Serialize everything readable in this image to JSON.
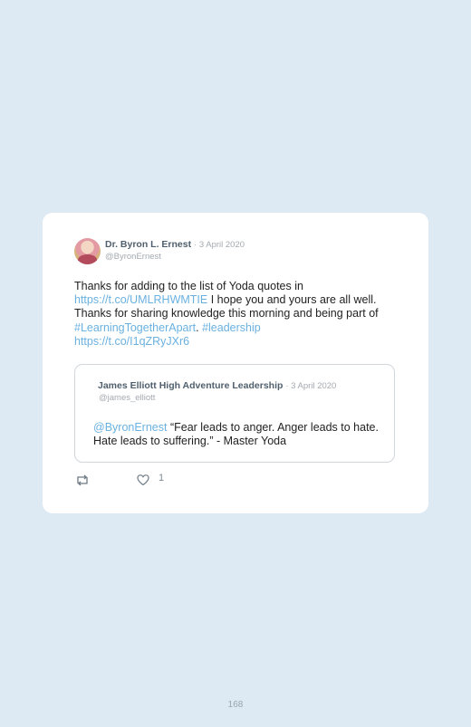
{
  "tweet": {
    "author_name": "Dr. Byron L. Ernest",
    "date": "· 3 April 2020",
    "handle": "@ByronErnest",
    "text": {
      "part1": "Thanks for adding to the list of Yoda quotes in ",
      "link1": "https://t.co/UMLRHWMTIE",
      "part2": " I hope you and yours are all well. Thanks for sharing knowledge this morning and being part of ",
      "hashtag1": "#LearningTogetherApart",
      "part3": ". ",
      "hashtag2": "#leadership",
      "link2": "https://t.co/I1qZRyJXr6"
    },
    "like_count": "1"
  },
  "quoted_tweet": {
    "author_name": "James Elliott High Adventure Leadership",
    "date": "· 3 April 2020",
    "handle": "@james_elliott",
    "mention": "@ByronErnest",
    "text": " “Fear leads to anger. Anger leads to hate. Hate leads to suffering.” - Master Yoda"
  },
  "page_number": "168",
  "colors": {
    "background": "#ddeaf4",
    "link": "#6ab1e0",
    "name": "#4f5f6d",
    "muted": "#a3aab0"
  },
  "icons": [
    "retweet-icon",
    "heart-icon"
  ]
}
